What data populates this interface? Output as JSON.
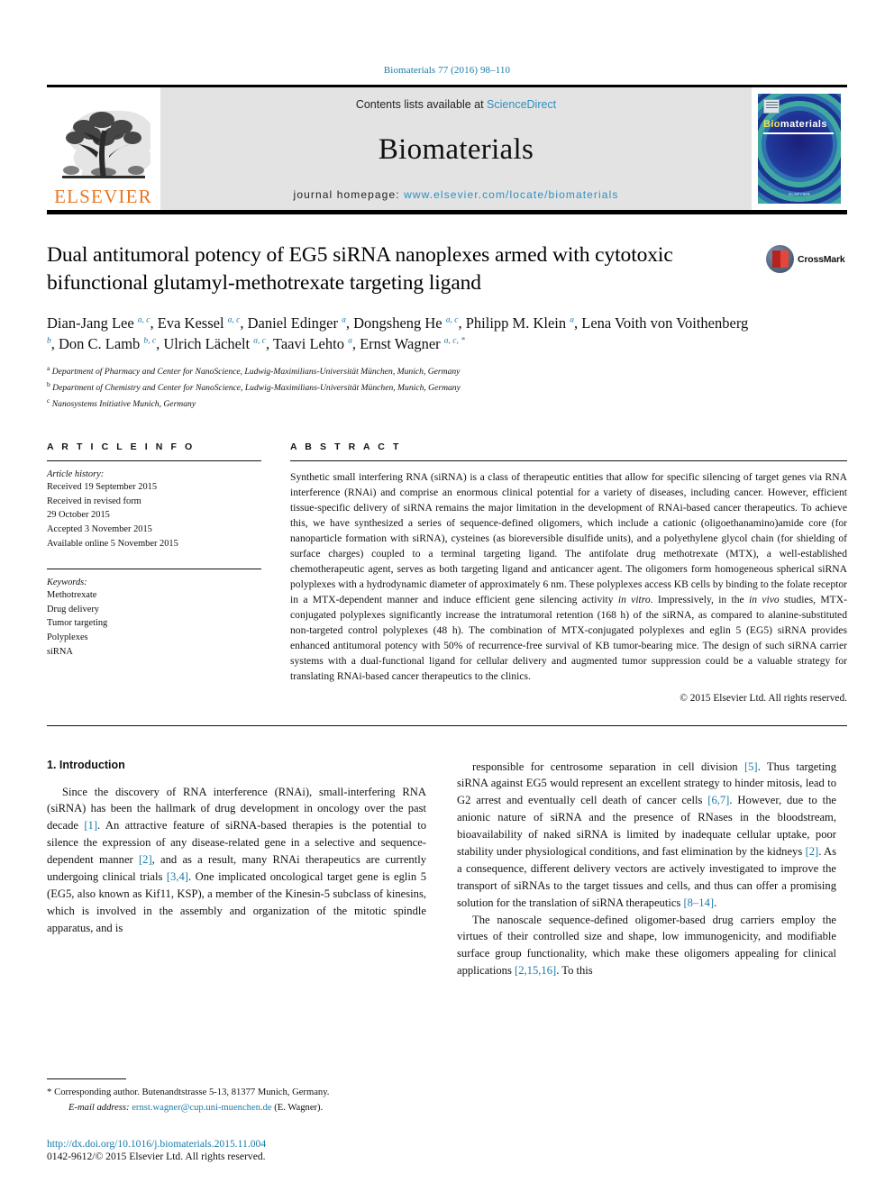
{
  "running_head": "Biomaterials 77 (2016) 98–110",
  "masthead": {
    "contents_prefix": "Contents lists available at ",
    "sciencedirect": "ScienceDirect",
    "journal_name": "Biomaterials",
    "homepage_prefix": "journal homepage: ",
    "homepage_url": "www.elsevier.com/locate/biomaterials",
    "publisher_logo_text": "ELSEVIER",
    "cover": {
      "title_bio": "Bio",
      "title_materials": "materials",
      "footer": "ELSEVIER"
    }
  },
  "article": {
    "title": "Dual antitumoral potency of EG5 siRNA nanoplexes armed with cytotoxic bifunctional glutamyl-methotrexate targeting ligand",
    "crossmark_label": "CrossMark",
    "authors_html": "Dian-Jang Lee <sup>a, c</sup>, Eva Kessel <sup>a, c</sup>, Daniel Edinger <sup>a</sup>, Dongsheng He <sup>a, c</sup>, Philipp M. Klein <sup>a</sup>, Lena Voith von Voithenberg <sup>b</sup>, Don C. Lamb <sup>b, c</sup>, Ulrich L&auml;chelt <sup>a, c</sup>, Taavi Lehto <sup>a</sup>, Ernst Wagner <sup>a, c, *</sup>",
    "affiliations": [
      {
        "label": "a",
        "text": "Department of Pharmacy and Center for NanoScience, Ludwig-Maximilians-Universität München, Munich, Germany"
      },
      {
        "label": "b",
        "text": "Department of Chemistry and Center for NanoScience, Ludwig-Maximilians-Universität München, Munich, Germany"
      },
      {
        "label": "c",
        "text": "Nanosystems Initiative Munich, Germany"
      }
    ]
  },
  "article_info": {
    "heading": "A R T I C L E  I N F O",
    "history_title": "Article history:",
    "history": [
      "Received 19 September 2015",
      "Received in revised form",
      "29 October 2015",
      "Accepted 3 November 2015",
      "Available online 5 November 2015"
    ],
    "keywords_title": "Keywords:",
    "keywords": [
      "Methotrexate",
      "Drug delivery",
      "Tumor targeting",
      "Polyplexes",
      "siRNA"
    ]
  },
  "abstract": {
    "heading": "A B S T R A C T",
    "text_html": "Synthetic small interfering RNA (siRNA) is a class of therapeutic entities that allow for specific silencing of target genes via RNA interference (RNAi) and comprise an enormous clinical potential for a variety of diseases, including cancer. However, efficient tissue-specific delivery of siRNA remains the major limitation in the development of RNAi-based cancer therapeutics. To achieve this, we have synthesized a series of sequence-defined oligomers, which include a cationic (oligoethanamino)amide core (for nanoparticle formation with siRNA), cysteines (as bioreversible disulfide units), and a polyethylene glycol chain (for shielding of surface charges) coupled to a terminal targeting ligand. The antifolate drug methotrexate (MTX), a well-established chemotherapeutic agent, serves as both targeting ligand and anticancer agent. The oligomers form homogeneous spherical siRNA polyplexes with a hydrodynamic diameter of approximately 6 nm. These polyplexes access KB cells by binding to the folate receptor in a MTX-dependent manner and induce efficient gene silencing activity <i>in vitro</i>. Impressively, in the <i>in vivo</i> studies, MTX-conjugated polyplexes significantly increase the intratumoral retention (168 h) of the siRNA, as compared to alanine-substituted non-targeted control polyplexes (48 h). The combination of MTX-conjugated polyplexes and eglin 5 (EG5) siRNA provides enhanced antitumoral potency with 50% of recurrence-free survival of KB tumor-bearing mice. The design of such siRNA carrier systems with a dual-functional ligand for cellular delivery and augmented tumor suppression could be a valuable strategy for translating RNAi-based cancer therapeutics to the clinics.",
    "copyright": "© 2015 Elsevier Ltd. All rights reserved."
  },
  "body": {
    "section_number_title": "1.  Introduction",
    "left_paragraphs_html": [
      "Since the discovery of RNA interference (RNAi), small-interfering RNA (siRNA) has been the hallmark of drug development in oncology over the past decade <span class=\"ref\">[1]</span>. An attractive feature of siRNA-based therapies is the potential to silence the expression of any disease-related gene in a selective and sequence-dependent manner <span class=\"ref\">[2]</span>, and as a result, many RNAi therapeutics are currently undergoing clinical trials <span class=\"ref\">[3,4]</span>. One implicated oncological target gene is eglin 5 (EG5, also known as Kif11, KSP), a member of the Kinesin-5 subclass of kinesins, which is involved in the assembly and organization of the mitotic spindle apparatus, and is"
    ],
    "right_paragraphs_html": [
      "responsible for centrosome separation in cell division <span class=\"ref\">[5]</span>. Thus targeting siRNA against EG5 would represent an excellent strategy to hinder mitosis, lead to G2 arrest and eventually cell death of cancer cells <span class=\"ref\">[6,7]</span>. However, due to the anionic nature of siRNA and the presence of RNases in the bloodstream, bioavailability of naked siRNA is limited by inadequate cellular uptake, poor stability under physiological conditions, and fast elimination by the kidneys <span class=\"ref\">[2]</span>. As a consequence, different delivery vectors are actively investigated to improve the transport of siRNAs to the target tissues and cells, and thus can offer a promising solution for the translation of siRNA therapeutics <span class=\"ref\">[8&ndash;14]</span>.",
      "The nanoscale sequence-defined oligomer-based drug carriers employ the virtues of their controlled size and shape, low immunogenicity, and modifiable surface group functionality, which make these oligomers appealing for clinical applications <span class=\"ref\">[2,15,16]</span>. To this"
    ]
  },
  "footnote": {
    "corresponding_html": "<span class=\"star\">*</span> Corresponding author. Butenandtstrasse 5-13, 81377 Munich, Germany.",
    "email_label": "E-mail address:",
    "email": "ernst.wagner@cup.uni-muenchen.de",
    "email_suffix": "(E. Wagner)."
  },
  "footer": {
    "doi": "http://dx.doi.org/10.1016/j.biomaterials.2015.11.004",
    "issn_line": "0142-9612/© 2015 Elsevier Ltd. All rights reserved."
  },
  "colors": {
    "link": "#1a7aa8",
    "elsevier_orange": "#e87722",
    "sciencedirect_blue": "#2f8fc0"
  }
}
